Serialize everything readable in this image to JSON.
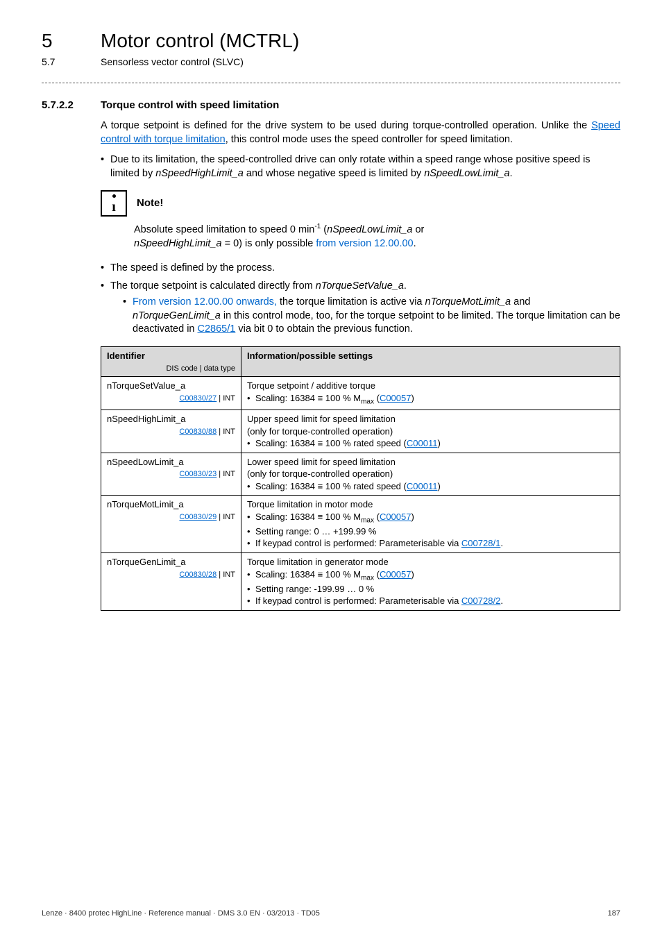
{
  "header": {
    "chapter_num": "5",
    "chapter_title": "Motor control (MCTRL)",
    "sub_num": "5.7",
    "sub_title": "Sensorless vector control (SLVC)"
  },
  "section": {
    "num": "5.7.2.2",
    "title": "Torque control with speed limitation",
    "para1_pre": "A torque setpoint is defined for the drive system to be used during torque-controlled operation. Unlike the ",
    "para1_link": "Speed control with torque limitation",
    "para1_post": ", this control mode uses the speed controller for speed limitation.",
    "bullet1_pre": "Due to its limitation, the speed-controlled drive can only rotate within a speed range whose positive speed is limited by ",
    "bullet1_i1": "nSpeedHighLimit_a",
    "bullet1_mid": " and whose negative speed is limited by ",
    "bullet1_i2": "nSpeedLowLimit_a",
    "bullet1_end": "."
  },
  "note": {
    "label": "Note!",
    "line1_pre": "Absolute speed limitation to speed 0 min",
    "line1_sup": "-1",
    "line1_open": " (",
    "line1_i1": "nSpeedLowLimit_a",
    "line1_mid": " or ",
    "line2_i2": "nSpeedHighLimit_a",
    "line2_mid": " = 0) is only possible ",
    "line2_link": "from version 12.00.00",
    "line2_end": "."
  },
  "after_note": {
    "b1": "The speed is defined by the process.",
    "b2_pre": "The torque setpoint is calculated directly from ",
    "b2_i": "nTorqueSetValue_a",
    "b2_end": ".",
    "sub_link": "From version 12.00.00 onwards,",
    "sub_pre": " the torque limitation is active via ",
    "sub_i1": "nTorqueMotLimit_a",
    "sub_mid1": " and ",
    "sub_i2": "nTorqueGenLimit_a",
    "sub_mid2": " in this control mode, too, for the torque setpoint to be limited. The torque limitation can be deactivated in ",
    "sub_code": "C2865/1",
    "sub_end": " via bit 0 to obtain the previous function."
  },
  "table": {
    "head_left": "Identifier",
    "head_left_sub": "DIS code | data type",
    "head_right": "Information/possible settings",
    "rows": [
      {
        "idName": "nTorqueSetValue_a",
        "idCode": "C00830/27",
        "idType": " | INT",
        "infoTitle": "Torque setpoint / additive torque",
        "bullets": [
          {
            "pre": "Scaling: 16384 ≡ 100 % M",
            "sub": "max",
            "open": " (",
            "link": "C00057",
            "close": ")"
          }
        ]
      },
      {
        "idName": "nSpeedHighLimit_a",
        "idCode": "C00830/88",
        "idType": " | INT",
        "infoTitle": "Upper speed limit for speed limitation",
        "infoLine2": "(only for torque-controlled operation)",
        "bullets": [
          {
            "pre": "Scaling: 16384 ≡ 100 % rated speed (",
            "link": "C00011",
            "close": ")"
          }
        ]
      },
      {
        "idName": "nSpeedLowLimit_a",
        "idCode": "C00830/23",
        "idType": " | INT",
        "infoTitle": "Lower speed limit for speed limitation",
        "infoLine2": "(only for torque-controlled operation)",
        "bullets": [
          {
            "pre": "Scaling: 16384 ≡ 100 % rated speed (",
            "link": "C00011",
            "close": ")"
          }
        ]
      },
      {
        "idName": "nTorqueMotLimit_a",
        "idCode": "C00830/29",
        "idType": " | INT",
        "infoTitle": "Torque limitation in motor mode",
        "bullets": [
          {
            "pre": "Scaling: 16384 ≡ 100 % M",
            "sub": "max",
            "open": " (",
            "link": "C00057",
            "close": ")"
          },
          {
            "plain": "Setting range: 0 … +199.99 %"
          },
          {
            "pre": "If keypad control is performed: Parameterisable via ",
            "link": "C00728/1",
            "close": "."
          }
        ]
      },
      {
        "idName": "nTorqueGenLimit_a",
        "idCode": "C00830/28",
        "idType": " | INT",
        "infoTitle": "Torque limitation in generator mode",
        "bullets": [
          {
            "pre": "Scaling: 16384 ≡ 100 % M",
            "sub": "max",
            "open": " (",
            "link": "C00057",
            "close": ")"
          },
          {
            "plain": "Setting range: -199.99 … 0 %"
          },
          {
            "pre": "If keypad control is performed: Parameterisable via ",
            "link": "C00728/2",
            "close": "."
          }
        ]
      }
    ]
  },
  "footer": {
    "left": "Lenze · 8400 protec HighLine · Reference manual · DMS 3.0 EN · 03/2013 · TD05",
    "right": "187"
  }
}
